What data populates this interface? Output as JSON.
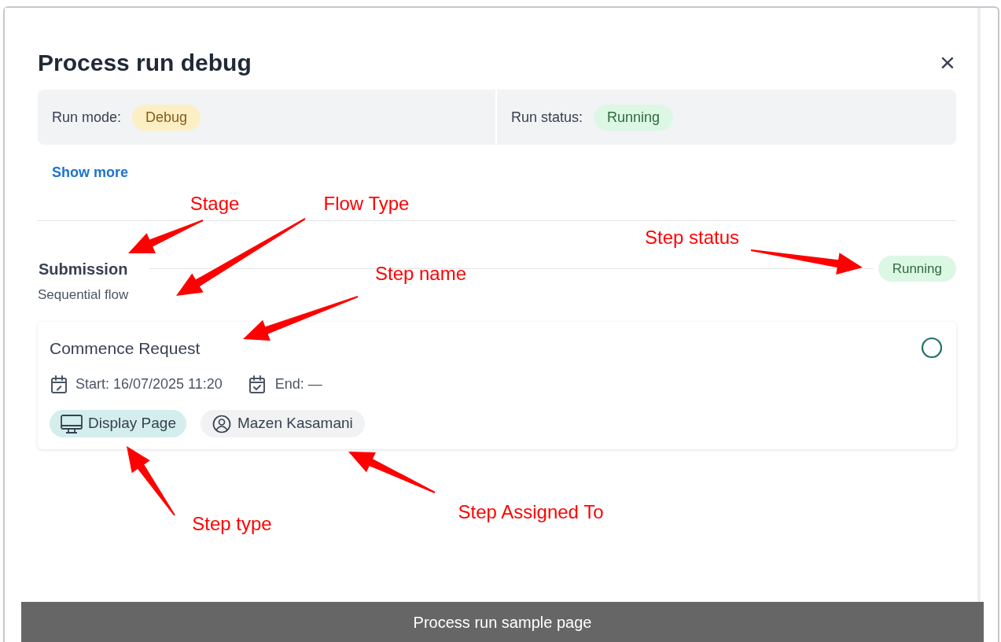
{
  "dialog": {
    "title": "Process run debug",
    "close": "×"
  },
  "summary": [
    {
      "label": "Run mode:",
      "value": "Debug",
      "kind": "warning"
    },
    {
      "label": "Run status:",
      "value": "Running",
      "kind": "success"
    }
  ],
  "show_more": "Show more",
  "stage": {
    "name": "Submission",
    "flow": "Sequential flow",
    "status": {
      "value": "Running",
      "kind": "success"
    }
  },
  "steps": [
    {
      "name": "Commence Request",
      "start": "Start: 16/07/2025 11:20",
      "end": "End: —",
      "type": "Display Page",
      "assignee": "Mazen Kasamani",
      "completed": false
    }
  ],
  "annotations": [
    {
      "text": "Stage"
    },
    {
      "text": "Flow Type"
    },
    {
      "text": "Step status"
    },
    {
      "text": "Step name"
    },
    {
      "text": "Step type"
    },
    {
      "text": "Step Assigned To"
    }
  ],
  "caption": "Process run sample page"
}
